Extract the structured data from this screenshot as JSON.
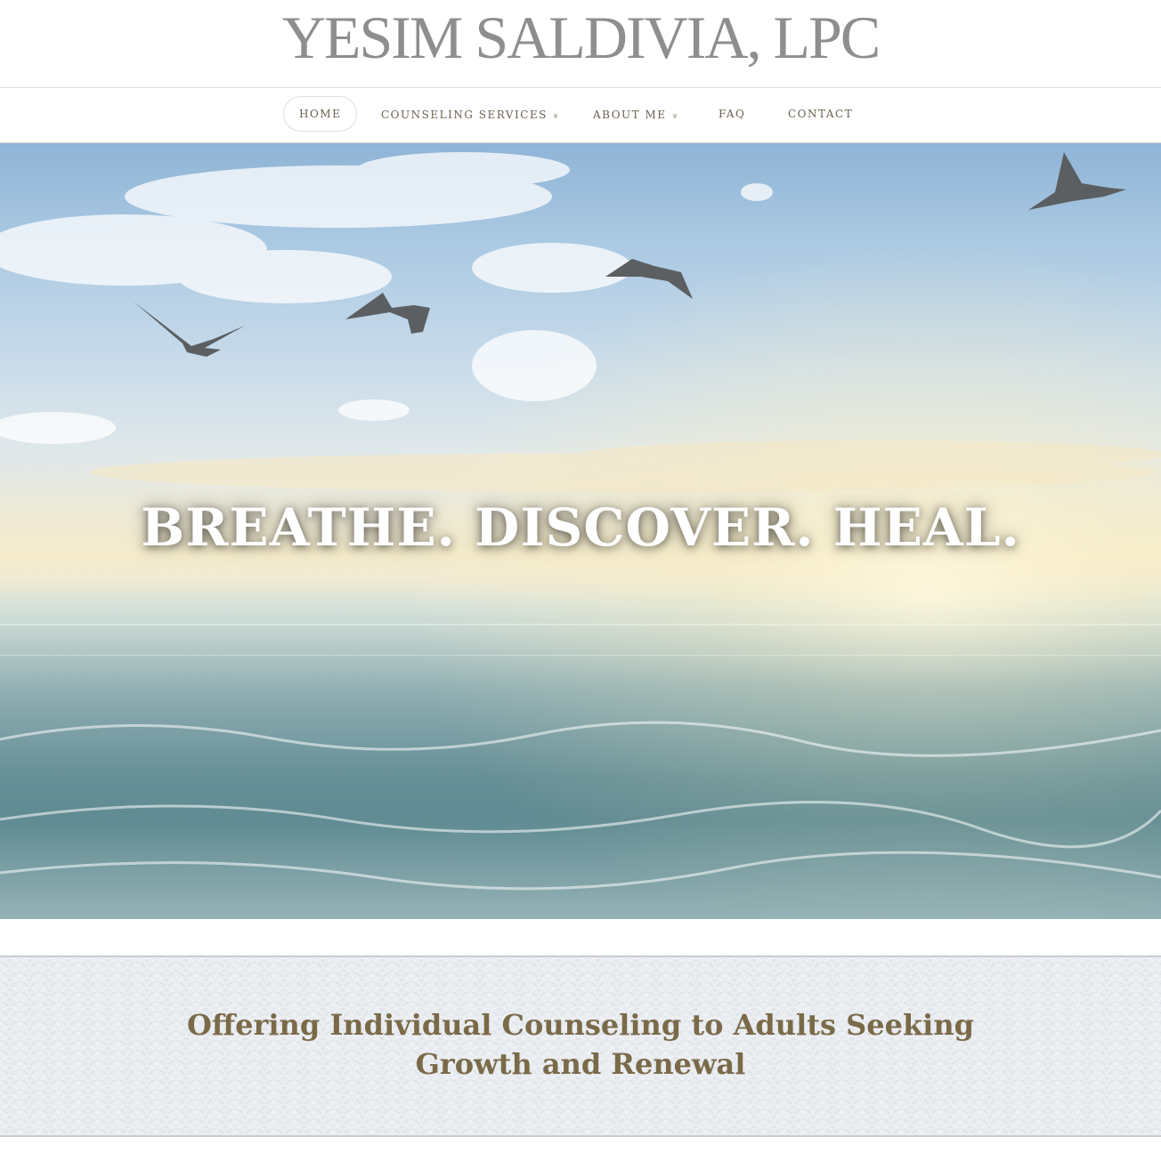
{
  "header": {
    "site_title": "YESIM SALDIVIA, LPC"
  },
  "nav": {
    "items": [
      {
        "label": "HOME",
        "active": true,
        "has_dropdown": false
      },
      {
        "label": "COUNSELING SERVICES",
        "active": false,
        "has_dropdown": true
      },
      {
        "label": "ABOUT ME",
        "active": false,
        "has_dropdown": true
      },
      {
        "label": "FAQ",
        "active": false,
        "has_dropdown": false
      },
      {
        "label": "CONTACT",
        "active": false,
        "has_dropdown": false
      }
    ],
    "dropdown_glyph": "»"
  },
  "hero": {
    "headline": "BREATHE. DISCOVER. HEAL.",
    "image_subject": "seagulls flying over ocean at sunset"
  },
  "tagline": {
    "heading": "Offering Individual Counseling to Adults Seeking Growth and Renewal"
  },
  "colors": {
    "title_gray": "#8e8e8e",
    "nav_text": "#6a6150",
    "tagline_brown": "#7a6a48",
    "band_bg": "#e9ecf0"
  }
}
